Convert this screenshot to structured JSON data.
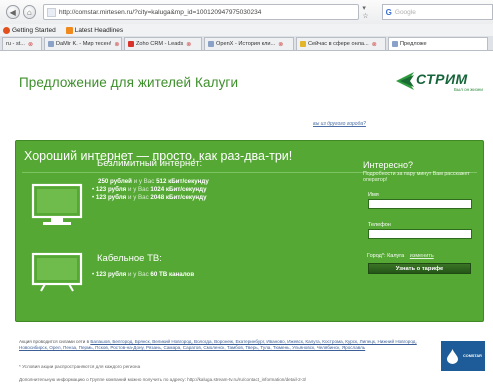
{
  "browser": {
    "url": "http://comstar.mirtesen.ru/?city=kaluga&mp_id=100120947975030234",
    "search_placeholder": "Google",
    "search_engine_glyph": "G",
    "bookmarks": [
      {
        "label": "Getting Started",
        "icon": "firefox-icon"
      },
      {
        "label": "Latest Headlines",
        "icon": "rss-icon"
      }
    ],
    "tabs": [
      {
        "label": "ru - st..."
      },
      {
        "label": "DaMir K. - Мир тесен!"
      },
      {
        "label": "Zoho CRM - Leads"
      },
      {
        "label": "OpenX - История кли..."
      },
      {
        "label": "Сейчас в сфере онла..."
      },
      {
        "label": "Предложе"
      }
    ]
  },
  "page": {
    "title": "Предложение для жителей Калуги",
    "region_link": "вы из другого города?",
    "logo": {
      "word": "СТРИМ",
      "sub": "Был он жизни"
    },
    "headline": "Хороший интернет — просто, как раз-два-три!",
    "internet": {
      "title": "Безлимитный интернет:",
      "rates": [
        {
          "price": "250 рублей",
          "mid": "и у Вас",
          "value": "512 кБит/секунду",
          "bullet": ""
        },
        {
          "price": "123 рубля",
          "mid": "и у Вас",
          "value": "1024 кБит/секунду",
          "bullet": "•"
        },
        {
          "price": "123 рубля",
          "mid": "и у Вас",
          "value": "2048 кБит/секунду",
          "bullet": "•"
        }
      ]
    },
    "tv": {
      "title": "Кабельное ТВ:",
      "rate": {
        "price": "123 рубля",
        "mid": "и у Вас",
        "value": "60 ТВ каналов",
        "bullet": "•"
      }
    },
    "form": {
      "title": "Интересно?",
      "description": "Подробности за пару минут Вам расскажет оператор!",
      "name_label": "Имя",
      "phone_label": "Телефон",
      "city_label": "Город*: Калуга",
      "change_link": "изменить",
      "submit_label": "Узнать о тарифе"
    },
    "footer": {
      "lead": "Акция проводится силами сети в",
      "cities": "Балашов, Белгород, Брянск, Великий Новгород, Вологда, Воронеж, Екатеринбург, Иваново, Ижевск, Калуга, Кострома, Курск, Липецк, Нижний Новгород, Новосибирск, Орел, Пенза, Пермь, Псков, Ростов-на-Дону, Рязань, Самара, Саратов, Смоленск, Тамбов, Тверь, Тула, Тюмень, Ульяновск, Челябинск, Ярославль",
      "note": "* Условия акции распространяются для каждого региона",
      "more": "Дополнительную информацию о Группе компаний можно получить по адресу: http://kaluga.stream-tv.ru/ru/contact_information/detail-2-3/",
      "badge": "COMSTAR"
    }
  },
  "colors": {
    "green_panel": "#55a834",
    "title_green": "#3c8f2a",
    "logo_green": "#16653a",
    "button_dark_green": "#245518",
    "badge_blue": "#1d5c98"
  }
}
